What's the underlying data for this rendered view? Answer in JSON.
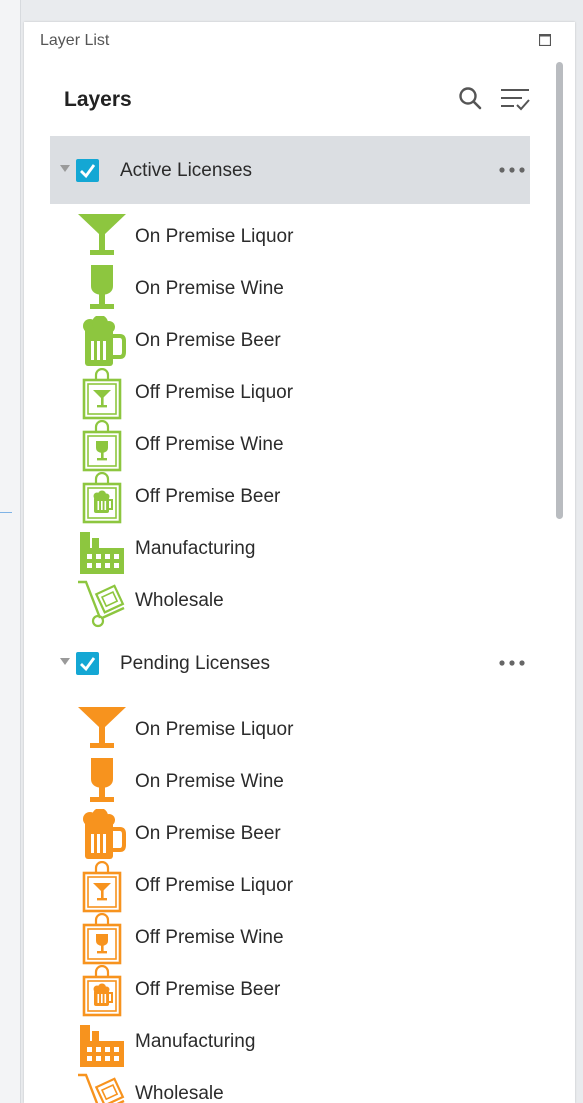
{
  "panel": {
    "title": "Layer List"
  },
  "header": {
    "title": "Layers"
  },
  "colors": {
    "active": "#8dc63f",
    "pending": "#f7931e",
    "checkbox": "#14a7d4"
  },
  "groups": [
    {
      "label": "Active Licenses",
      "checked": true,
      "selected": true,
      "items": [
        {
          "label": "On Premise Liquor",
          "icon": "cocktail-glass-icon"
        },
        {
          "label": "On Premise Wine",
          "icon": "wine-glass-icon"
        },
        {
          "label": "On Premise Beer",
          "icon": "beer-mug-icon"
        },
        {
          "label": "Off Premise Liquor",
          "icon": "liquor-bag-icon"
        },
        {
          "label": "Off Premise Wine",
          "icon": "wine-bag-icon"
        },
        {
          "label": "Off Premise Beer",
          "icon": "beer-bag-icon"
        },
        {
          "label": "Manufacturing",
          "icon": "factory-icon"
        },
        {
          "label": "Wholesale",
          "icon": "hand-truck-icon"
        }
      ]
    },
    {
      "label": "Pending Licenses",
      "checked": true,
      "selected": false,
      "items": [
        {
          "label": "On Premise Liquor",
          "icon": "cocktail-glass-icon"
        },
        {
          "label": "On Premise Wine",
          "icon": "wine-glass-icon"
        },
        {
          "label": "On Premise Beer",
          "icon": "beer-mug-icon"
        },
        {
          "label": "Off Premise Liquor",
          "icon": "liquor-bag-icon"
        },
        {
          "label": "Off Premise Wine",
          "icon": "wine-bag-icon"
        },
        {
          "label": "Off Premise Beer",
          "icon": "beer-bag-icon"
        },
        {
          "label": "Manufacturing",
          "icon": "factory-icon"
        },
        {
          "label": "Wholesale",
          "icon": "hand-truck-icon"
        }
      ]
    }
  ]
}
